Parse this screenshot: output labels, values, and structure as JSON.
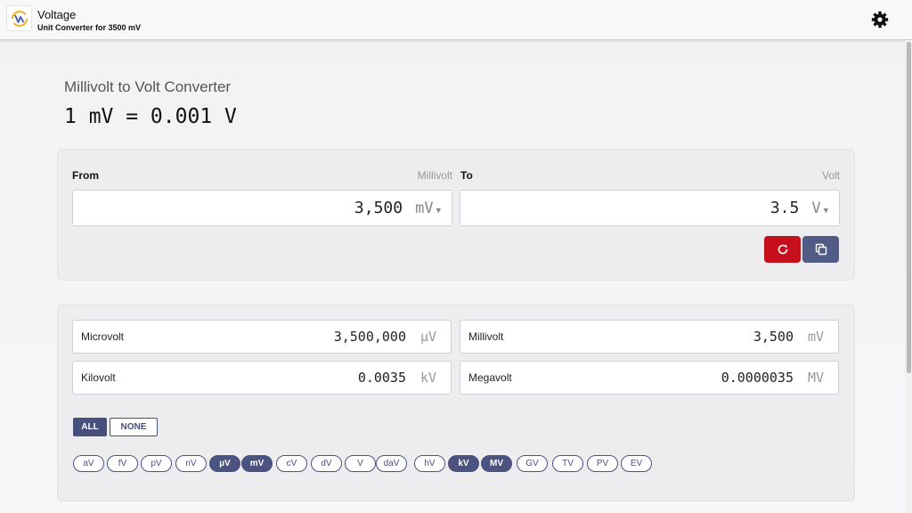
{
  "header": {
    "app_name": "Voltage",
    "subtitle": "Unit Converter for 3500 mV",
    "logo_icon": "voltage-logo-icon",
    "settings_icon": "gear-icon"
  },
  "page": {
    "title": "Millivolt to Volt Converter",
    "formula": "1 mV = 0.001 V"
  },
  "converter": {
    "from_label": "From",
    "from_unit_name": "Millivolt",
    "from_value": "3,500",
    "from_unit": "mV",
    "to_label": "To",
    "to_unit_name": "Volt",
    "to_value": "3.5",
    "to_unit": "V",
    "reset_icon": "reset-icon",
    "copy_icon": "copy-icon",
    "reset_color": "#c5101c",
    "copy_color": "#525b85"
  },
  "results": [
    {
      "name": "Microvolt",
      "value": "3,500,000",
      "unit": "µV"
    },
    {
      "name": "Millivolt",
      "value": "3,500",
      "unit": "mV"
    },
    {
      "name": "Kilovolt",
      "value": "0.0035",
      "unit": "kV"
    },
    {
      "name": "Megavolt",
      "value": "0.0000035",
      "unit": "MV"
    }
  ],
  "toggles": {
    "all_label": "ALL",
    "none_label": "NONE"
  },
  "chips": [
    {
      "label": "aV",
      "active": false
    },
    {
      "label": "fV",
      "active": false
    },
    {
      "label": "pV",
      "active": false
    },
    {
      "label": "nV",
      "active": false
    },
    {
      "label": "µV",
      "active": true
    },
    {
      "label": "mV",
      "active": true
    },
    {
      "label": "cV",
      "active": false
    },
    {
      "label": "dV",
      "active": false
    },
    {
      "label": "V",
      "active": false
    },
    {
      "label": "daV",
      "active": false
    },
    {
      "label": "hV",
      "active": false
    },
    {
      "label": "kV",
      "active": true
    },
    {
      "label": "MV",
      "active": true
    },
    {
      "label": "GV",
      "active": false
    },
    {
      "label": "TV",
      "active": false
    },
    {
      "label": "PV",
      "active": false
    },
    {
      "label": "EV",
      "active": false
    }
  ],
  "colors": {
    "accent": "#47507c",
    "danger": "#c5101c"
  }
}
